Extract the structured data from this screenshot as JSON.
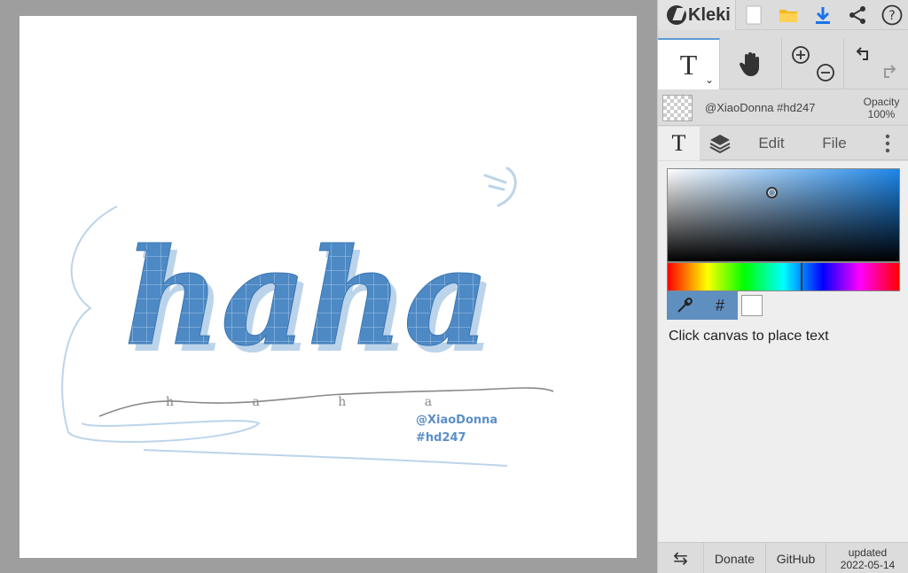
{
  "app": {
    "name": "Kleki",
    "accent": "#5b9bd5"
  },
  "topbar": {
    "logo_icon": "kleki-logo-icon",
    "buttons": [
      {
        "name": "new-file-icon"
      },
      {
        "name": "open-folder-icon"
      },
      {
        "name": "download-icon"
      },
      {
        "name": "share-icon"
      },
      {
        "name": "help-icon",
        "glyph": "?"
      }
    ]
  },
  "tools": {
    "text_tool_label": "T",
    "hand_icon": "hand-icon",
    "zoom_in_icon": "zoom-in-icon",
    "zoom_out_icon": "zoom-out-icon",
    "undo_icon": "undo-icon",
    "redo_icon": "redo-icon"
  },
  "layer": {
    "name": "@XiaoDonna #hd247",
    "opacity_label": "Opacity",
    "opacity_value": "100%"
  },
  "tabs": {
    "text_tab": "T",
    "layers_icon": "layers-icon",
    "edit": "Edit",
    "file": "File"
  },
  "color": {
    "selected": "#ffffff",
    "eyedropper_icon": "eyedropper-icon",
    "hex_label": "#"
  },
  "hint": "Click canvas to place text",
  "bottom": {
    "swap_icon": "swap-icon",
    "donate": "Donate",
    "github": "GitHub",
    "updated_label": "updated",
    "updated_date": "2022-05-14"
  },
  "artwork": {
    "main_word": "haha",
    "script_word": "h a h a",
    "signature_line1": "@XiaoDonna",
    "signature_line2": "#hd247",
    "fill_color": "#4d89c4",
    "shadow_color": "#bcd4ea",
    "line_color": "#888888"
  }
}
